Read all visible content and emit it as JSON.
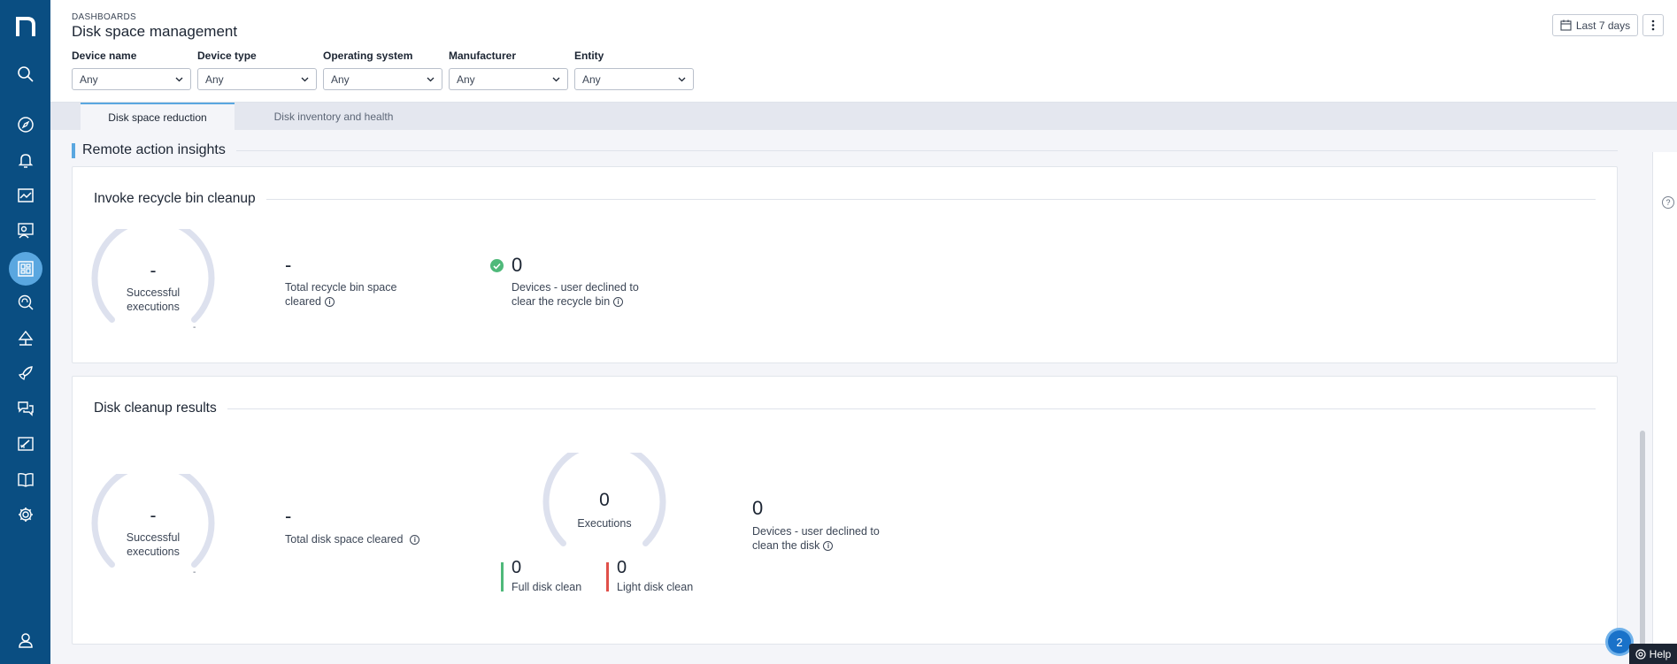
{
  "header": {
    "breadcrumb": "DASHBOARDS",
    "title": "Disk space management",
    "date_range": "Last 7 days"
  },
  "filters": [
    {
      "label": "Device name",
      "value": "Any"
    },
    {
      "label": "Device type",
      "value": "Any"
    },
    {
      "label": "Operating system",
      "value": "Any"
    },
    {
      "label": "Manufacturer",
      "value": "Any"
    },
    {
      "label": "Entity",
      "value": "Any"
    }
  ],
  "tabs": [
    {
      "label": "Disk space reduction",
      "active": true
    },
    {
      "label": "Disk inventory and health",
      "active": false
    }
  ],
  "section": {
    "title": "Remote action insights"
  },
  "recycle_card": {
    "title": "Invoke recycle bin cleanup",
    "gauge": {
      "value": "-",
      "label_line1": "Successful",
      "label_line2": "executions",
      "min_label": "-"
    },
    "metric1": {
      "value": "-",
      "label_line1": "Total recycle bin space",
      "label_line2": "cleared"
    },
    "metric2": {
      "value": "0",
      "label_line1": "Devices - user declined to",
      "label_line2": "clear the recycle bin"
    }
  },
  "disk_card": {
    "title": "Disk cleanup results",
    "gauge": {
      "value": "-",
      "label_line1": "Successful",
      "label_line2": "executions",
      "min_label": "-"
    },
    "metric1": {
      "value": "-",
      "label": "Total disk space cleared"
    },
    "exec_gauge": {
      "value": "0",
      "label": "Executions"
    },
    "full": {
      "value": "0",
      "label": "Full disk clean"
    },
    "light": {
      "value": "0",
      "label": "Light disk clean"
    },
    "metric3": {
      "value": "0",
      "label_line1": "Devices - user declined to",
      "label_line2": "clean the disk"
    }
  },
  "help": {
    "badge": "2",
    "label": "Help"
  },
  "colors": {
    "sidebar": "#0a4e82",
    "accent": "#5aa7e0",
    "full_clean": "#4fb97a",
    "light_clean": "#e0504a",
    "gauge_track": "#dde1ee"
  },
  "icons": [
    "nexthink-logo",
    "search-icon",
    "compass-icon",
    "bell-icon",
    "chart-icon",
    "people-search-icon",
    "dashboard-icon",
    "fingerprint-search-icon",
    "tree-icon",
    "rocket-icon",
    "chat-icon",
    "edit-chart-icon",
    "book-icon",
    "gear-icon",
    "user-icon"
  ]
}
